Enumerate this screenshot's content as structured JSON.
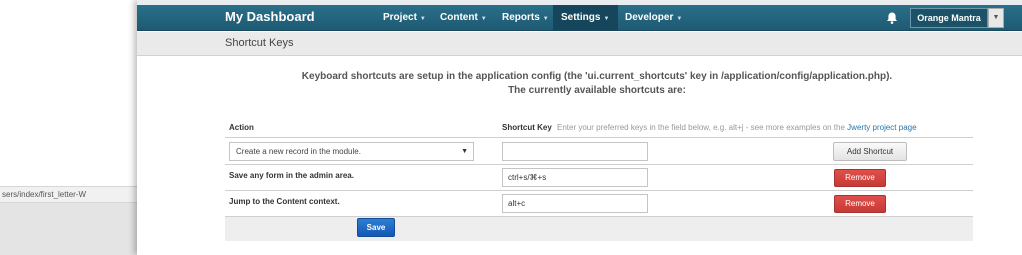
{
  "background": {
    "status_url": "sers/index/first_letter-W"
  },
  "navbar": {
    "brand": "My Dashboard",
    "items": [
      {
        "label": "Project",
        "active": false
      },
      {
        "label": "Content",
        "active": false
      },
      {
        "label": "Reports",
        "active": false
      },
      {
        "label": "Settings",
        "active": true
      },
      {
        "label": "Developer",
        "active": false
      }
    ],
    "icons": {
      "notifications": "bell-icon",
      "dropdown": "caret-down-icon"
    },
    "user": "Orange Mantra",
    "colors": {
      "bar": "#1f5a73",
      "active": "#16465b"
    }
  },
  "page": {
    "title": "Shortcut Keys",
    "intro_line1": "Keyboard shortcuts are setup in the application config (the 'ui.current_shortcuts' key in /application/config/application.php).",
    "intro_line2": "The currently available shortcuts are:"
  },
  "table": {
    "header_action": "Action",
    "header_key": "Shortcut Key",
    "hint_text": "Enter your preferred keys in the field below, e.g. alt+j - see more examples on the",
    "hint_link": "Jwerty project page",
    "new_row": {
      "select_value": "Create a new record in the module.",
      "key_value": "",
      "button": "Add Shortcut"
    },
    "rows": [
      {
        "action": "Save any form in the admin area.",
        "key": "ctrl+s/⌘+s",
        "button": "Remove"
      },
      {
        "action": "Jump to the Content context.",
        "key": "alt+c",
        "button": "Remove"
      }
    ],
    "save_button": "Save",
    "colors": {
      "remove": "#c63a35",
      "save": "#1558b4"
    }
  }
}
